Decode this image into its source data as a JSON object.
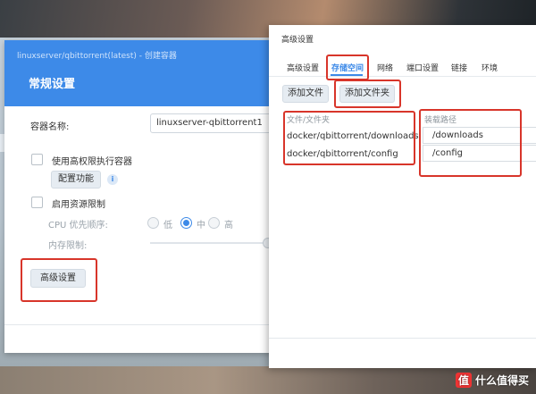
{
  "window_title": "linuxserver/qbittorrent(latest) - 创建容器",
  "general": {
    "heading": "常规设置",
    "container_name_label": "容器名称:",
    "container_name_value": "linuxserver-qbittorrent1",
    "high_priv_label": "使用高权限执行容器",
    "configure_btn": "配置功能",
    "info_icon": "i",
    "resource_limit_label": "启用资源限制",
    "cpu_label": "CPU 优先顺序:",
    "cpu_options": [
      "低",
      "中",
      "高"
    ],
    "cpu_selected": "中",
    "memory_label": "内存限制:",
    "advanced_btn": "高级设置"
  },
  "advanced": {
    "title": "高级设置",
    "tabs": [
      "高级设置",
      "存储空间",
      "网络",
      "端口设置",
      "链接",
      "环境"
    ],
    "active_tab": "存储空间",
    "add_file_btn": "添加文件",
    "add_folder_btn": "添加文件夹",
    "col_file": "文件/文件夹",
    "col_mount": "装载路径",
    "rows": [
      {
        "folder": "docker/qbittorrent/downloads",
        "mount": "/downloads"
      },
      {
        "folder": "docker/qbittorrent/config",
        "mount": "/config"
      }
    ]
  },
  "watermark": "值 什么值得买",
  "accent_color": "#3d8ae8",
  "highlight_color": "#d8352a"
}
